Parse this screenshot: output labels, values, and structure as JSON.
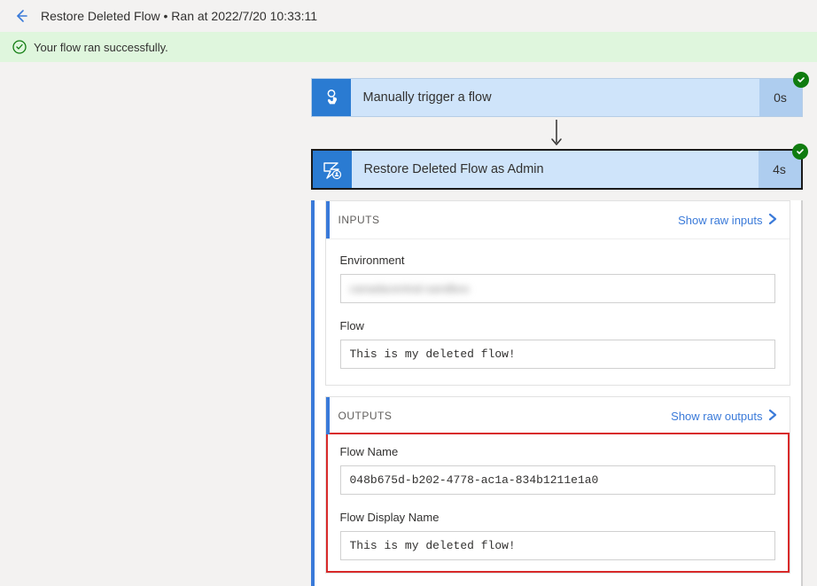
{
  "header": {
    "title": "Restore Deleted Flow  •  Ran at 2022/7/20 10:33:11"
  },
  "successBar": {
    "message": "Your flow ran successfully."
  },
  "trigger": {
    "title": "Manually trigger a flow",
    "duration": "0s"
  },
  "action": {
    "title": "Restore Deleted Flow as Admin",
    "duration": "4s"
  },
  "inputs": {
    "sectionLabel": "INPUTS",
    "showRawLabel": "Show raw inputs",
    "fields": {
      "environment": {
        "label": "Environment",
        "value": "canadacentral-sandbox"
      },
      "flow": {
        "label": "Flow",
        "value": "This is my deleted flow!"
      }
    }
  },
  "outputs": {
    "sectionLabel": "OUTPUTS",
    "showRawLabel": "Show raw outputs",
    "fields": {
      "flowName": {
        "label": "Flow Name",
        "value": "048b675d-b202-4778-ac1a-834b1211e1a0"
      },
      "flowDisplayName": {
        "label": "Flow Display Name",
        "value": "This is my deleted flow!"
      }
    }
  }
}
